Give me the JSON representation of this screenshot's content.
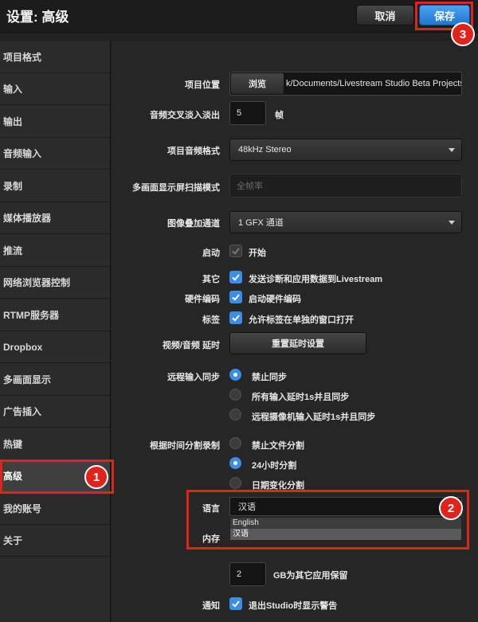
{
  "header": {
    "title": "设置: 高级",
    "cancel_label": "取消",
    "save_label": "保存"
  },
  "badges": {
    "b1": "1",
    "b2": "2",
    "b3": "3"
  },
  "sidebar": {
    "items": [
      {
        "label": "项目格式"
      },
      {
        "label": "输入"
      },
      {
        "label": "输出"
      },
      {
        "label": "音频输入"
      },
      {
        "label": "录制"
      },
      {
        "label": "媒体播放器"
      },
      {
        "label": "推流"
      },
      {
        "label": "网络浏览器控制"
      },
      {
        "label": "RTMP服务器"
      },
      {
        "label": "Dropbox"
      },
      {
        "label": "多画面显示"
      },
      {
        "label": "广告插入"
      },
      {
        "label": "热键"
      },
      {
        "label": "高级"
      },
      {
        "label": "我的账号"
      },
      {
        "label": "关于"
      }
    ],
    "active_index": 13
  },
  "settings": {
    "project_location": {
      "label": "项目位置",
      "browse_label": "浏览",
      "path": "k/Documents/Livestream Studio Beta Projects/"
    },
    "audio_crossfade": {
      "label": "音频交叉淡入淡出",
      "value": "5",
      "unit": "帧"
    },
    "audio_format": {
      "label": "项目音频格式",
      "value": "48kHz Stereo"
    },
    "multiview_scan": {
      "label": "多画面显示屏扫描模式",
      "placeholder": "全帧率"
    },
    "overlay_channel": {
      "label": "图像叠加通道",
      "value": "1 GFX 通道"
    },
    "startup": {
      "label": "启动",
      "option": "开始",
      "checked": false
    },
    "other": {
      "label": "其它",
      "option": "发送诊断和应用数据到Livestream",
      "checked": true
    },
    "hw_encode": {
      "label": "硬件编码",
      "option": "启动硬件编码",
      "checked": true
    },
    "tabs": {
      "label": "标签",
      "option": "允许标签在单独的窗口打开",
      "checked": true
    },
    "av_delay": {
      "label": "视频/音频 延时",
      "button": "重置延时设置"
    },
    "remote_sync": {
      "label": "远程输入同步",
      "options": [
        "禁止同步",
        "所有输入延时1s并且同步",
        "远程摄像机输入延时1s并且同步"
      ],
      "selected": 0
    },
    "split_record": {
      "label": "根据时间分割录制",
      "options": [
        "禁止文件分割",
        "24小时分割",
        "日期变化分割"
      ],
      "selected": 1
    },
    "language": {
      "label": "语言",
      "value": "汉语",
      "options": [
        "English",
        "汉语"
      ],
      "selected": 1
    },
    "memory": {
      "label": "内存",
      "value": "2",
      "unit": "GB为其它应用保留"
    },
    "notify": {
      "label": "通知",
      "option": "退出Studio时显示警告",
      "checked": true
    }
  },
  "colors": {
    "accent": "#3a8ee6",
    "highlight": "#e0241c"
  }
}
